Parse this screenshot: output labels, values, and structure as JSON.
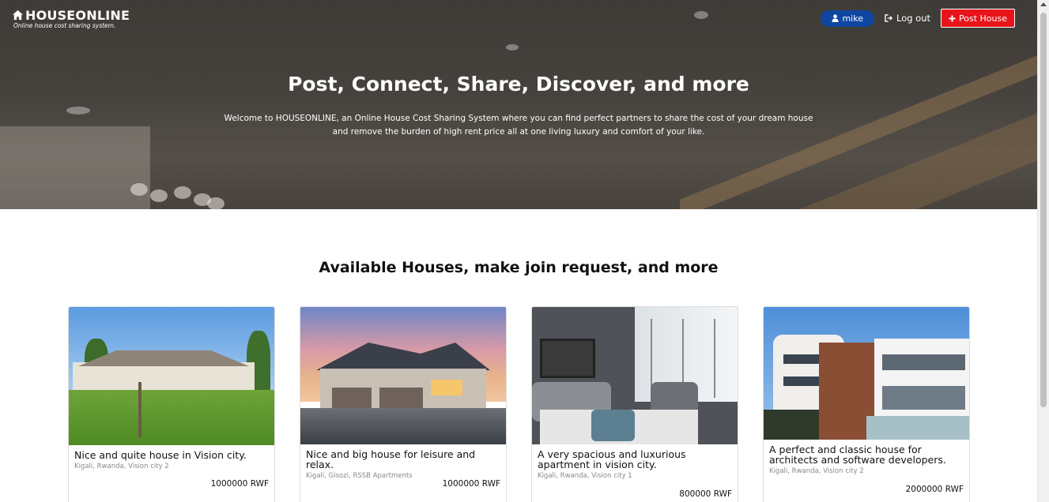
{
  "brand": {
    "name": "HOUSEONLINE",
    "tagline": "Online house cost sharing system."
  },
  "nav": {
    "user": "mike",
    "logout": "Log out",
    "post": "Post House"
  },
  "hero": {
    "title": "Post, Connect, Share, Discover, and more",
    "text": "Welcome to HOUSEONLINE, an Online House Cost Sharing System where you can find perfect partners to share the cost of your dream house and remove the burden of high rent price all at one living luxury and comfort of your like."
  },
  "section": {
    "title": "Available Houses, make join request, and more"
  },
  "houses": [
    {
      "title": "Nice and quite house in Vision city.",
      "location": "Kigali, Rwanda, Vision city 2",
      "price": "1000000 RWF"
    },
    {
      "title": "Nice and big house for leisure and relax.",
      "location": "Kigali, Gisozi, RSSB Apartments",
      "price": "1000000 RWF"
    },
    {
      "title": "A very spacious and luxurious apartment in vision city.",
      "location": "Kigali, Rwanda, Vision city 1",
      "price": "800000 RWF"
    },
    {
      "title": "A perfect and classic house for architects and software developers.",
      "location": "Kigali, Rwanda, Vision city 2",
      "price": "2000000 RWF"
    }
  ],
  "icons": {
    "brand": "house-icon",
    "user": "user-icon",
    "logout": "sign-out-icon",
    "post": "plus-icon"
  },
  "colors": {
    "accent": "#e8141a",
    "user_pill": "#0d47a1"
  }
}
